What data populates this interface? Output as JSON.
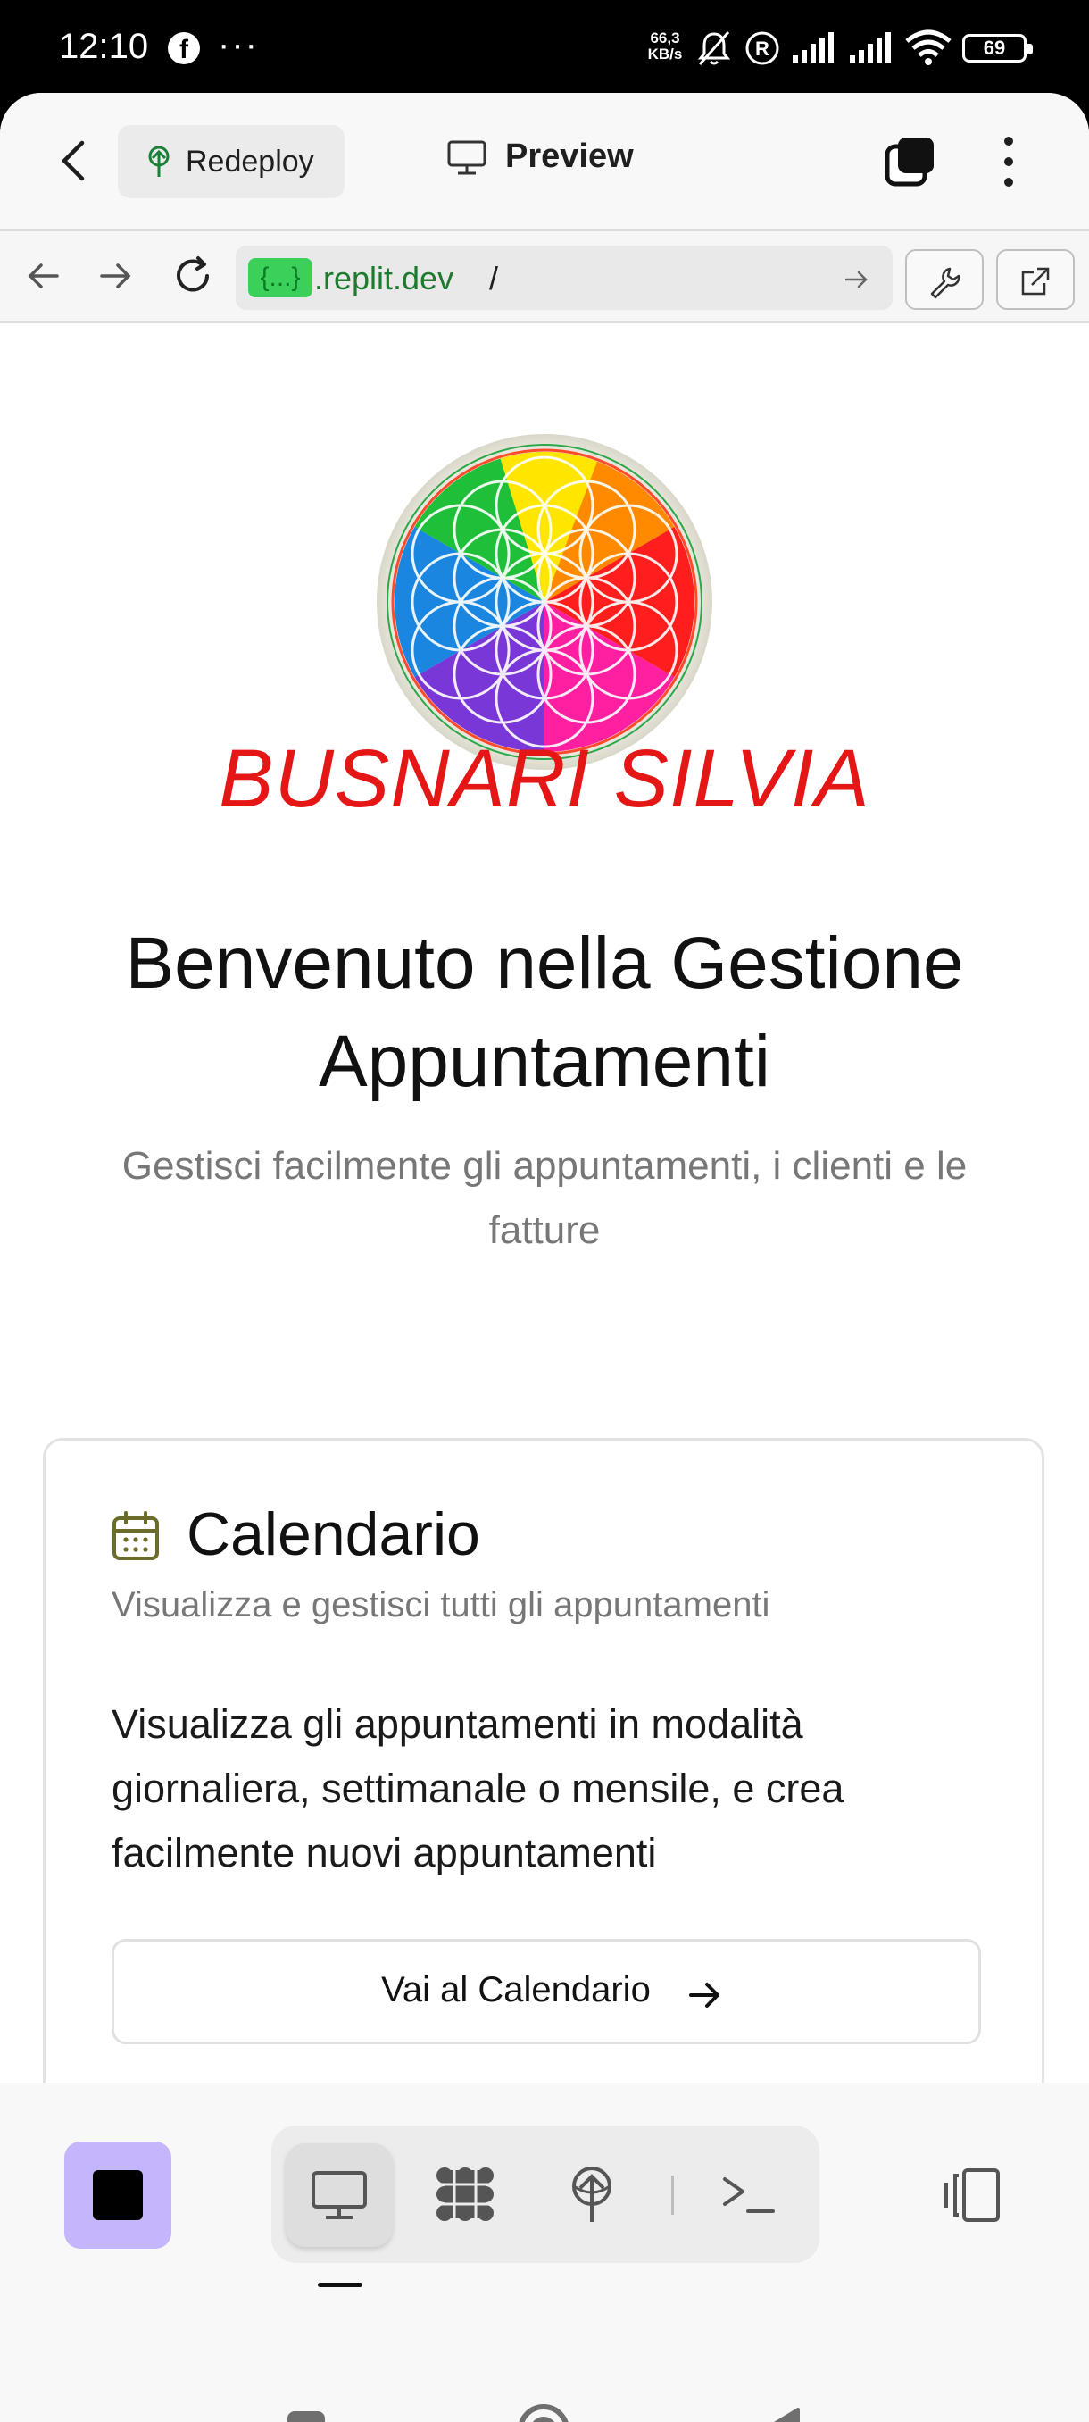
{
  "status_bar": {
    "time": "12:10",
    "overflow": "···",
    "speed_value": "66,3",
    "speed_unit": "KB/s",
    "battery": "69"
  },
  "toolbar": {
    "redeploy_label": "Redeploy",
    "preview_label": "Preview"
  },
  "address_bar": {
    "host_tag": "{...}",
    "host": ".replit.dev",
    "path": "/"
  },
  "page": {
    "brand_name": "BUSNARI SILVIA",
    "welcome_title": "Benvenuto nella Gestione Appuntamenti",
    "welcome_subtitle": "Gestisci facilmente gli appuntamenti, i clienti e le fatture"
  },
  "card": {
    "title": "Calendario",
    "description": "Visualizza e gestisci tutti gli appuntamenti",
    "body": "Visualizza gli appuntamenti in modalità giornaliera, settimanale o mensile, e crea facilmente nuovi appuntamenti",
    "button_label": "Vai al Calendario"
  },
  "colors": {
    "brand_red": "#e41616",
    "stop_button": "#c4b5fd",
    "url_host_green": "#1e7a2e",
    "calendar_icon": "#6b6b2a"
  },
  "icons": {
    "back": "chevron-left-icon",
    "redeploy": "deploy-icon",
    "preview": "monitor-icon",
    "tabs": "tabs-icon",
    "menu": "kebab-menu-icon",
    "calendar": "calendar-icon",
    "workflows": "grid-icon",
    "deploy": "deploy-icon",
    "shell": "terminal-icon",
    "side_panel": "side-panel-icon"
  }
}
